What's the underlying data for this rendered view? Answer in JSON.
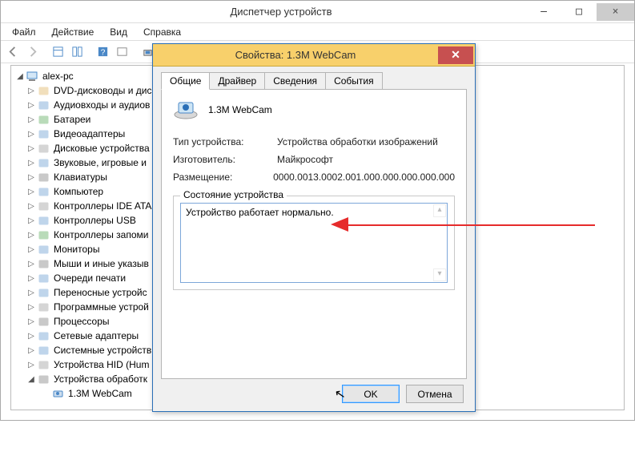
{
  "main": {
    "title": "Диспетчер устройств",
    "winbtns": {
      "min": "—",
      "max": "□",
      "close": "×"
    },
    "menu": [
      "Файл",
      "Действие",
      "Вид",
      "Справка"
    ],
    "root": "alex-pc",
    "nodes": [
      {
        "label": "DVD-дисководы и дис",
        "icon": "disc"
      },
      {
        "label": "Аудиовходы и аудиов",
        "icon": "audio"
      },
      {
        "label": "Батареи",
        "icon": "battery"
      },
      {
        "label": "Видеоадаптеры",
        "icon": "display"
      },
      {
        "label": "Дисковые устройства",
        "icon": "hdd"
      },
      {
        "label": "Звуковые, игровые и",
        "icon": "sound"
      },
      {
        "label": "Клавиатуры",
        "icon": "keyboard"
      },
      {
        "label": "Компьютер",
        "icon": "computer"
      },
      {
        "label": "Контроллеры IDE ATA",
        "icon": "ide"
      },
      {
        "label": "Контроллеры USB",
        "icon": "usb"
      },
      {
        "label": "Контроллеры запоми",
        "icon": "storage"
      },
      {
        "label": "Мониторы",
        "icon": "monitor"
      },
      {
        "label": "Мыши и иные указыв",
        "icon": "mouse"
      },
      {
        "label": "Очереди печати",
        "icon": "printer"
      },
      {
        "label": "Переносные устройс",
        "icon": "portable"
      },
      {
        "label": "Программные устрой",
        "icon": "software"
      },
      {
        "label": "Процессоры",
        "icon": "cpu"
      },
      {
        "label": "Сетевые адаптеры",
        "icon": "network"
      },
      {
        "label": "Системные устройств",
        "icon": "system"
      },
      {
        "label": "Устройства HID (Hum",
        "icon": "hid"
      },
      {
        "label": "Устройства обработк",
        "icon": "imaging",
        "expanded": true
      }
    ],
    "child": "1.3M WebCam"
  },
  "dialog": {
    "title": "Свойства: 1.3M WebCam",
    "tabs": [
      "Общие",
      "Драйвер",
      "Сведения",
      "События"
    ],
    "activeTab": 0,
    "device_name": "1.3M WebCam",
    "rows": {
      "type_k": "Тип устройства:",
      "type_v": "Устройства обработки изображений",
      "mfg_k": "Изготовитель:",
      "mfg_v": "Майкрософт",
      "loc_k": "Размещение:",
      "loc_v": "0000.0013.0002.001.000.000.000.000.000"
    },
    "status_legend": "Состояние устройства",
    "status_text": "Устройство работает нормально.",
    "buttons": {
      "ok": "OK",
      "cancel": "Отмена"
    }
  }
}
